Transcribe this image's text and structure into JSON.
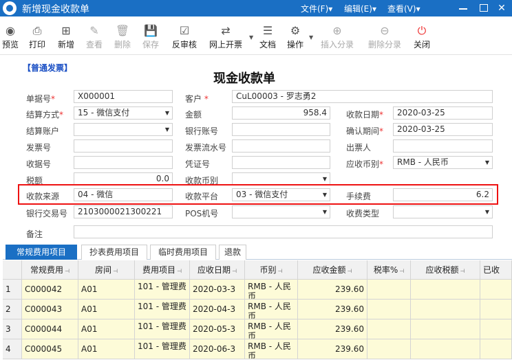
{
  "window": {
    "title": "新增现金收款单",
    "menus": [
      "文件(F)▾",
      "编辑(E)▾",
      "查看(V)▾"
    ],
    "controls": [
      "—",
      "☐",
      "✕"
    ]
  },
  "toolbar": [
    {
      "label": "预览",
      "icon": "eye-icon",
      "glyph": "◉",
      "enabled": true
    },
    {
      "label": "打印",
      "icon": "printer-icon",
      "glyph": "⎙",
      "enabled": true
    },
    {
      "label": "新增",
      "icon": "add-doc-icon",
      "glyph": "⊞",
      "enabled": true
    },
    {
      "label": "查看",
      "icon": "edit-icon",
      "glyph": "✎",
      "enabled": false
    },
    {
      "label": "删除",
      "icon": "trash-icon",
      "glyph": "🗑",
      "enabled": false
    },
    {
      "label": "保存",
      "icon": "save-icon",
      "glyph": "💾",
      "enabled": false
    },
    {
      "label": "反审核",
      "icon": "check-icon",
      "glyph": "☑",
      "enabled": true
    },
    {
      "label": "网上开票",
      "icon": "transfer-icon",
      "glyph": "⇄",
      "enabled": true
    },
    {
      "label": "文档",
      "icon": "document-icon",
      "glyph": "☰",
      "enabled": true
    },
    {
      "label": "操作",
      "icon": "gear-icon",
      "glyph": "⚙",
      "enabled": true
    },
    {
      "label": "插入分录",
      "icon": "plus-circle-icon",
      "glyph": "⊕",
      "enabled": false
    },
    {
      "label": "删除分录",
      "icon": "minus-circle-icon",
      "glyph": "⊖",
      "enabled": false
    },
    {
      "label": "关闭",
      "icon": "power-icon",
      "glyph": "⏻",
      "enabled": true
    }
  ],
  "form": {
    "invoice_type": "【普通发票】",
    "title": "现金收款单",
    "req_mark": "*",
    "labels": {
      "doc_no": "单据号",
      "customer": "客户",
      "settle_method": "结算方式",
      "amount": "金额",
      "receive_date": "收款日期",
      "settle_account": "结算账户",
      "bank_account": "银行账号",
      "confirm_period": "确认期间",
      "invoice_no": "发票号",
      "invoice_flow_no": "发票流水号",
      "drawer": "出票人",
      "receipt_no": "收据号",
      "voucher_no": "凭证号",
      "ar_currency": "应收币别",
      "tax": "税额",
      "receive_currency": "收款币别",
      "receive_source": "收款来源",
      "receive_platform": "收款平台",
      "fee": "手续费",
      "bank_txn_no": "银行交易号",
      "pos_no": "POS机号",
      "charge_type": "收费类型",
      "remark": "备注"
    },
    "values": {
      "doc_no": "X000001",
      "customer": "CuL00003 - 罗志勇2",
      "settle_method": "15 - 微信支付",
      "amount": "958.4",
      "receive_date": "2020-03-25",
      "settle_account": "",
      "bank_account": "",
      "confirm_period": "2020-03-25",
      "invoice_no": "",
      "invoice_flow_no": "",
      "drawer": "",
      "receipt_no": "",
      "voucher_no": "",
      "ar_currency": "RMB - 人民币",
      "tax": "0.0",
      "receive_currency": "",
      "receive_source": "04 - 微信",
      "receive_platform": "03 - 微信支付",
      "fee": "6.2",
      "bank_txn_no": "2103000021300221",
      "pos_no": "",
      "charge_type": "",
      "remark": ""
    }
  },
  "tabs": [
    "常规费用项目",
    "抄表费用项目",
    "临时费用项目",
    "退款"
  ],
  "grid": {
    "columns": [
      "常规费用",
      "房间",
      "费用项目",
      "应收日期",
      "币别",
      "应收金额",
      "税率%",
      "应收税额",
      "已收"
    ],
    "rows": [
      {
        "n": "1",
        "code": "C000042",
        "room": "A01",
        "item": "101 - 管理费",
        "date": "2020-03-3",
        "currency": "RMB - 人民币",
        "amount": "239.60",
        "tax_rate": "",
        "tax_amount": "",
        "received": ""
      },
      {
        "n": "2",
        "code": "C000043",
        "room": "A01",
        "item": "101 - 管理费",
        "date": "2020-04-3",
        "currency": "RMB - 人民币",
        "amount": "239.60",
        "tax_rate": "",
        "tax_amount": "",
        "received": ""
      },
      {
        "n": "3",
        "code": "C000044",
        "room": "A01",
        "item": "101 - 管理费",
        "date": "2020-05-3",
        "currency": "RMB - 人民币",
        "amount": "239.60",
        "tax_rate": "",
        "tax_amount": "",
        "received": ""
      },
      {
        "n": "4",
        "code": "C000045",
        "room": "A01",
        "item": "101 - 管理费",
        "date": "2020-06-3",
        "currency": "RMB - 人民币",
        "amount": "239.60",
        "tax_rate": "",
        "tax_amount": "",
        "received": ""
      }
    ]
  },
  "colors": {
    "titlebar": "#1a6fc4",
    "highlight": "#e11111",
    "grid_row": "#fdfbd8",
    "required": "#e33333"
  }
}
